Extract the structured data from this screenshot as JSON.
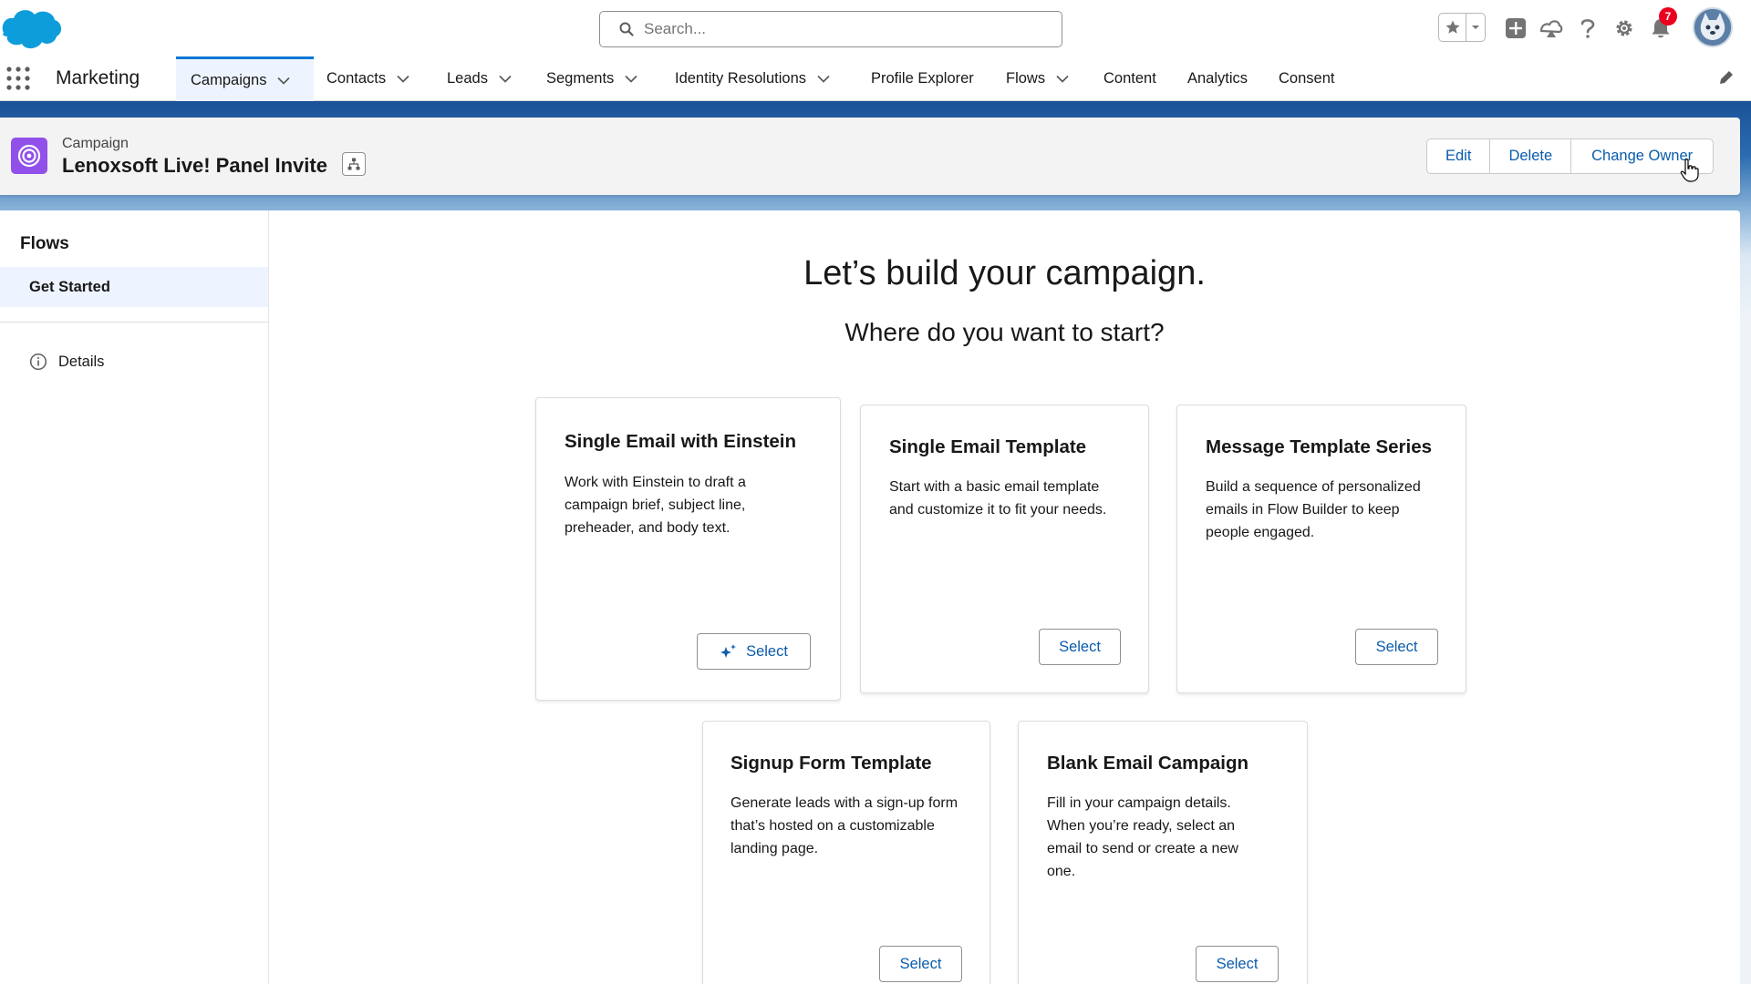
{
  "header": {
    "search_placeholder": "Search...",
    "notification_count": "7",
    "icons": [
      "salesforce-cloud-logo",
      "search-icon",
      "star-icon",
      "chevron-down-icon",
      "plus-icon",
      "trailhead-icon",
      "help-icon",
      "gear-icon",
      "bell-icon",
      "avatar"
    ]
  },
  "nav": {
    "app_name": "Marketing",
    "items": [
      {
        "label": "Campaigns",
        "has_menu": true,
        "active": true
      },
      {
        "label": "Contacts",
        "has_menu": true
      },
      {
        "label": "Leads",
        "has_menu": true
      },
      {
        "label": "Segments",
        "has_menu": true
      },
      {
        "label": "Identity Resolutions",
        "has_menu": true
      },
      {
        "label": "Profile Explorer",
        "has_menu": false
      },
      {
        "label": "Flows",
        "has_menu": true
      },
      {
        "label": "Content",
        "has_menu": false
      },
      {
        "label": "Analytics",
        "has_menu": false
      },
      {
        "label": "Consent",
        "has_menu": false
      }
    ]
  },
  "record": {
    "type": "Campaign",
    "title": "Lenoxsoft Live! Panel Invite",
    "actions": [
      "Edit",
      "Delete",
      "Change Owner"
    ]
  },
  "sidebar": {
    "title": "Flows",
    "selected": "Get Started",
    "details": "Details"
  },
  "main": {
    "heading": "Let’s build your campaign.",
    "subheading": "Where do you want to start?",
    "cards": [
      {
        "title": "Single Email with Einstein",
        "description": "Work with Einstein to draft a campaign brief, subject line, preheader, and body text.",
        "button": "Select"
      },
      {
        "title": "Single Email Template",
        "description": "Start with a basic email template and customize it to fit your needs.",
        "button": "Select"
      },
      {
        "title": "Message Template Series",
        "description": "Build a sequence of personalized emails in Flow Builder to keep people engaged.",
        "button": "Select"
      },
      {
        "title": "Signup Form Template",
        "description": "Generate leads with a sign-up form that’s hosted on a customizable landing page.",
        "button": "Select"
      },
      {
        "title": "Blank Email Campaign",
        "description": "Fill in your campaign details. When you’re ready, select an email to send or create a new one.",
        "button": "Select"
      }
    ]
  },
  "colors": {
    "brand_blue": "#0176d3",
    "link_blue": "#0b5cab",
    "campaign_icon": "#9050e9",
    "notification_red": "#ea001e"
  }
}
